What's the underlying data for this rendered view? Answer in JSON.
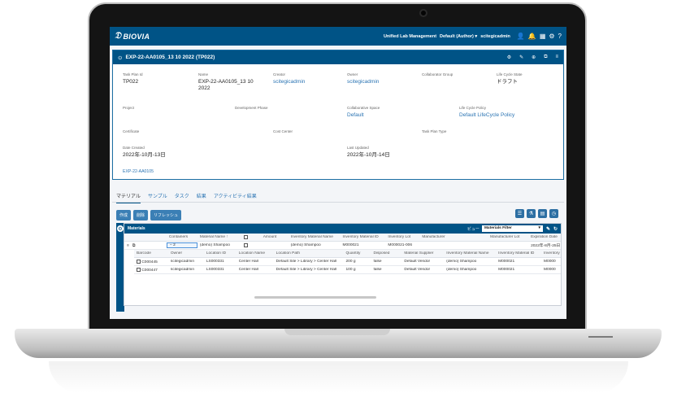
{
  "header": {
    "logo_text": "BIOVIA",
    "app_name": "Unified Lab Management",
    "role": "Default (Author) ▾",
    "user": "scitegicadmin"
  },
  "panel": {
    "title": "EXP-22-AA0105_13 10 2022 (TP022)",
    "fields": {
      "task_plan_id": {
        "label": "Task Plan Id",
        "value": "TP022"
      },
      "name": {
        "label": "Name",
        "value": "EXP-22-AA0105_13 10 2022"
      },
      "creator": {
        "label": "Creator",
        "value": "scitegicadmin"
      },
      "owner": {
        "label": "Owner",
        "value": "scitegicadmin"
      },
      "collab_group": {
        "label": "Collaborator Group",
        "value": ""
      },
      "lifecycle_state": {
        "label": "Life Cycle State",
        "value": "ドラフト"
      },
      "project": {
        "label": "Project",
        "value": ""
      },
      "dev_phase": {
        "label": "Development Phase",
        "value": ""
      },
      "collab_space": {
        "label": "Collaborative Space",
        "value": "Default"
      },
      "lifecycle_policy": {
        "label": "Life Cycle Policy",
        "value": "Default LifeCycle Policy"
      },
      "certificate": {
        "label": "Certificate",
        "value": ""
      },
      "cost_center": {
        "label": "Cost Center",
        "value": ""
      },
      "task_plan_type": {
        "label": "Task Plan Type",
        "value": ""
      },
      "date_created": {
        "label": "Date Created",
        "value": "2022年-10月-13日"
      },
      "last_updated": {
        "label": "Last Updated",
        "value": "2022年-10月-14日"
      }
    },
    "experiment_link": "EXP-22-AA0105"
  },
  "tabs": [
    "マテリアル",
    "サンプル",
    "タスク",
    "結果",
    "アクティビティ結果"
  ],
  "buttons": {
    "create": "作成",
    "delete": "削除",
    "refresh": "リフレッシュ"
  },
  "materials": {
    "title": "Materials",
    "view_label": "ビュー",
    "view_select": "Materials Filter",
    "columns": [
      "Containers",
      "Material Name ↑",
      "",
      "Amount",
      "Inventory Material Name",
      "Inventory Material ID",
      "Inventory Lot",
      "Manufacturer",
      "Manufacturer Lot",
      "Expiration Date"
    ],
    "row": {
      "containers": "2",
      "material_name": "(demo) Shampoo",
      "amount": "",
      "inv_material_name": "(demo) Shampoo",
      "inv_material_id": "M000021",
      "inv_lot": "M000021-006",
      "manufacturer": "",
      "manufacturer_lot": "",
      "expiration": "2022年-8月-25日 23"
    },
    "sub_columns": [
      "Barcode",
      "Owner",
      "Location ID",
      "Location Name",
      "Location Path",
      "Quantity",
      "Disposed",
      "Material Supplier",
      "Inventory Material Name",
      "Inventory Material ID",
      "Inventory"
    ],
    "sub_rows": [
      [
        "C000445",
        "scitegicadmin",
        "LS000331",
        "Center Hall",
        "Default Site > Library > Center Hall",
        "200 g",
        "false",
        "Default Vendor",
        "(demo) Shampoo",
        "M000021",
        "M0000"
      ],
      [
        "C000447",
        "scitegicadmin",
        "LS000331",
        "Center Hall",
        "Default Site > Library > Center Hall",
        "100 g",
        "false",
        "Default Vendor",
        "(demo) Shampoo",
        "M000021",
        "M0000"
      ]
    ]
  }
}
